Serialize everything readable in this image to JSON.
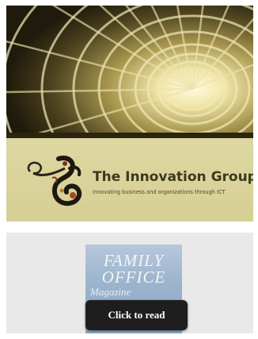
{
  "banner": {
    "photo_icon": "vaulted-tunnel-photo",
    "brand_name": "The Innovation Group",
    "tagline": "Innovating business and organizations through ICT",
    "panel_color": "#d9d39a"
  },
  "magazine": {
    "cover_title_line1": "FAMILY",
    "cover_title_line2": "OFFICE",
    "cover_script": "Magazine",
    "read_button_label": "Click to read",
    "button_color": "#1e1e1e"
  }
}
